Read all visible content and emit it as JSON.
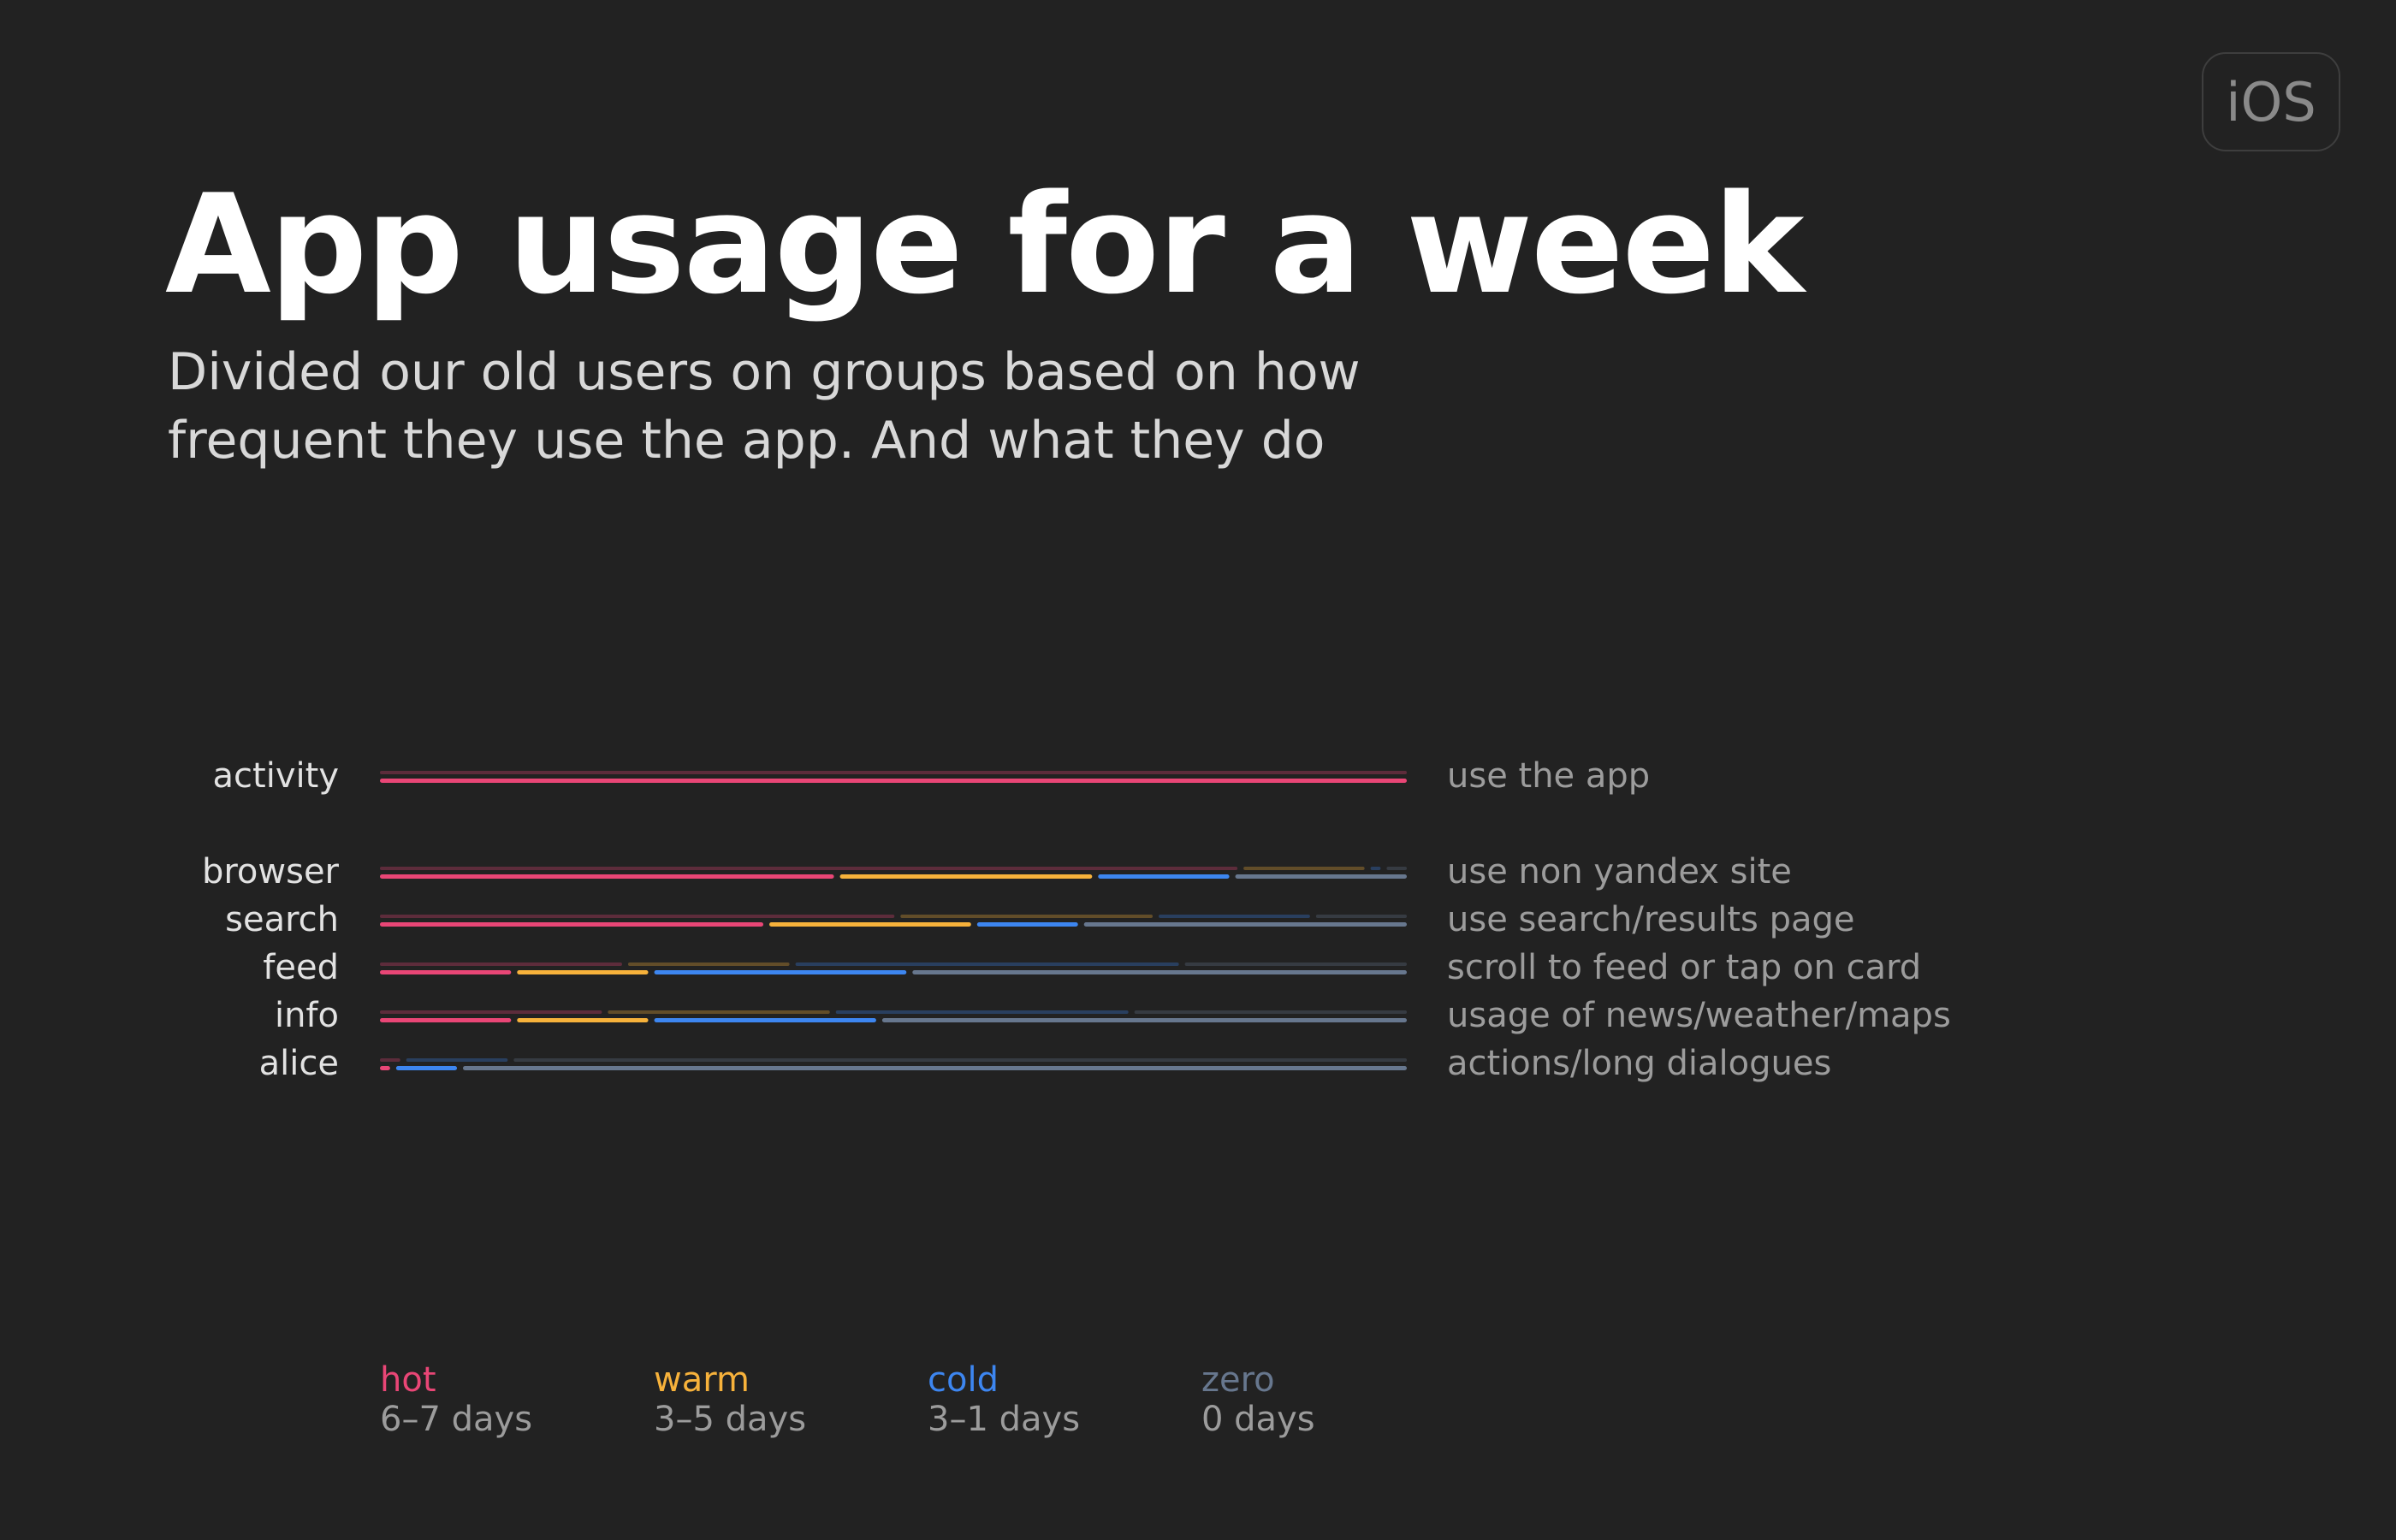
{
  "badge": "iOS",
  "title": "App usage for a week",
  "subtitle": [
    "Divided our old users on groups based on how",
    "frequent they use the app. And what they do"
  ],
  "chart_data": {
    "type": "bar",
    "orientation": "horizontal",
    "stacked": true,
    "scale": "share of users, %",
    "groups": [
      {
        "name": "hot",
        "range": "6–7 days",
        "color": "#e94676"
      },
      {
        "name": "warm",
        "range": "3–5 days",
        "color": "#f7b23b"
      },
      {
        "name": "cold",
        "range": "3–1 days",
        "color": "#3d86f0"
      },
      {
        "name": "zero",
        "range": "0 days",
        "color": "#67778e"
      }
    ],
    "rows": [
      {
        "label": "activity",
        "description": "use the app",
        "background": [
          100,
          0,
          0,
          0
        ],
        "values": [
          100,
          0,
          0,
          0
        ]
      },
      {
        "label": "browser",
        "description": "use non yandex site",
        "background": [
          85,
          12,
          1,
          2
        ],
        "values": [
          45,
          25,
          13,
          17
        ]
      },
      {
        "label": "search",
        "description": "use search/results page",
        "background": [
          51,
          25,
          15,
          9
        ],
        "values": [
          38,
          20,
          10,
          32
        ]
      },
      {
        "label": "feed",
        "description": "scroll to feed or tap on card",
        "background": [
          24,
          16,
          38,
          22
        ],
        "values": [
          13,
          13,
          25,
          49
        ]
      },
      {
        "label": "info",
        "description": "usage of news/weather/maps",
        "background": [
          22,
          22,
          29,
          27
        ],
        "values": [
          13,
          13,
          22,
          52
        ]
      },
      {
        "label": "alice",
        "description": "actions/long dialogues",
        "background": [
          2,
          0,
          10,
          88
        ],
        "values": [
          1,
          0,
          6,
          93
        ]
      }
    ]
  }
}
